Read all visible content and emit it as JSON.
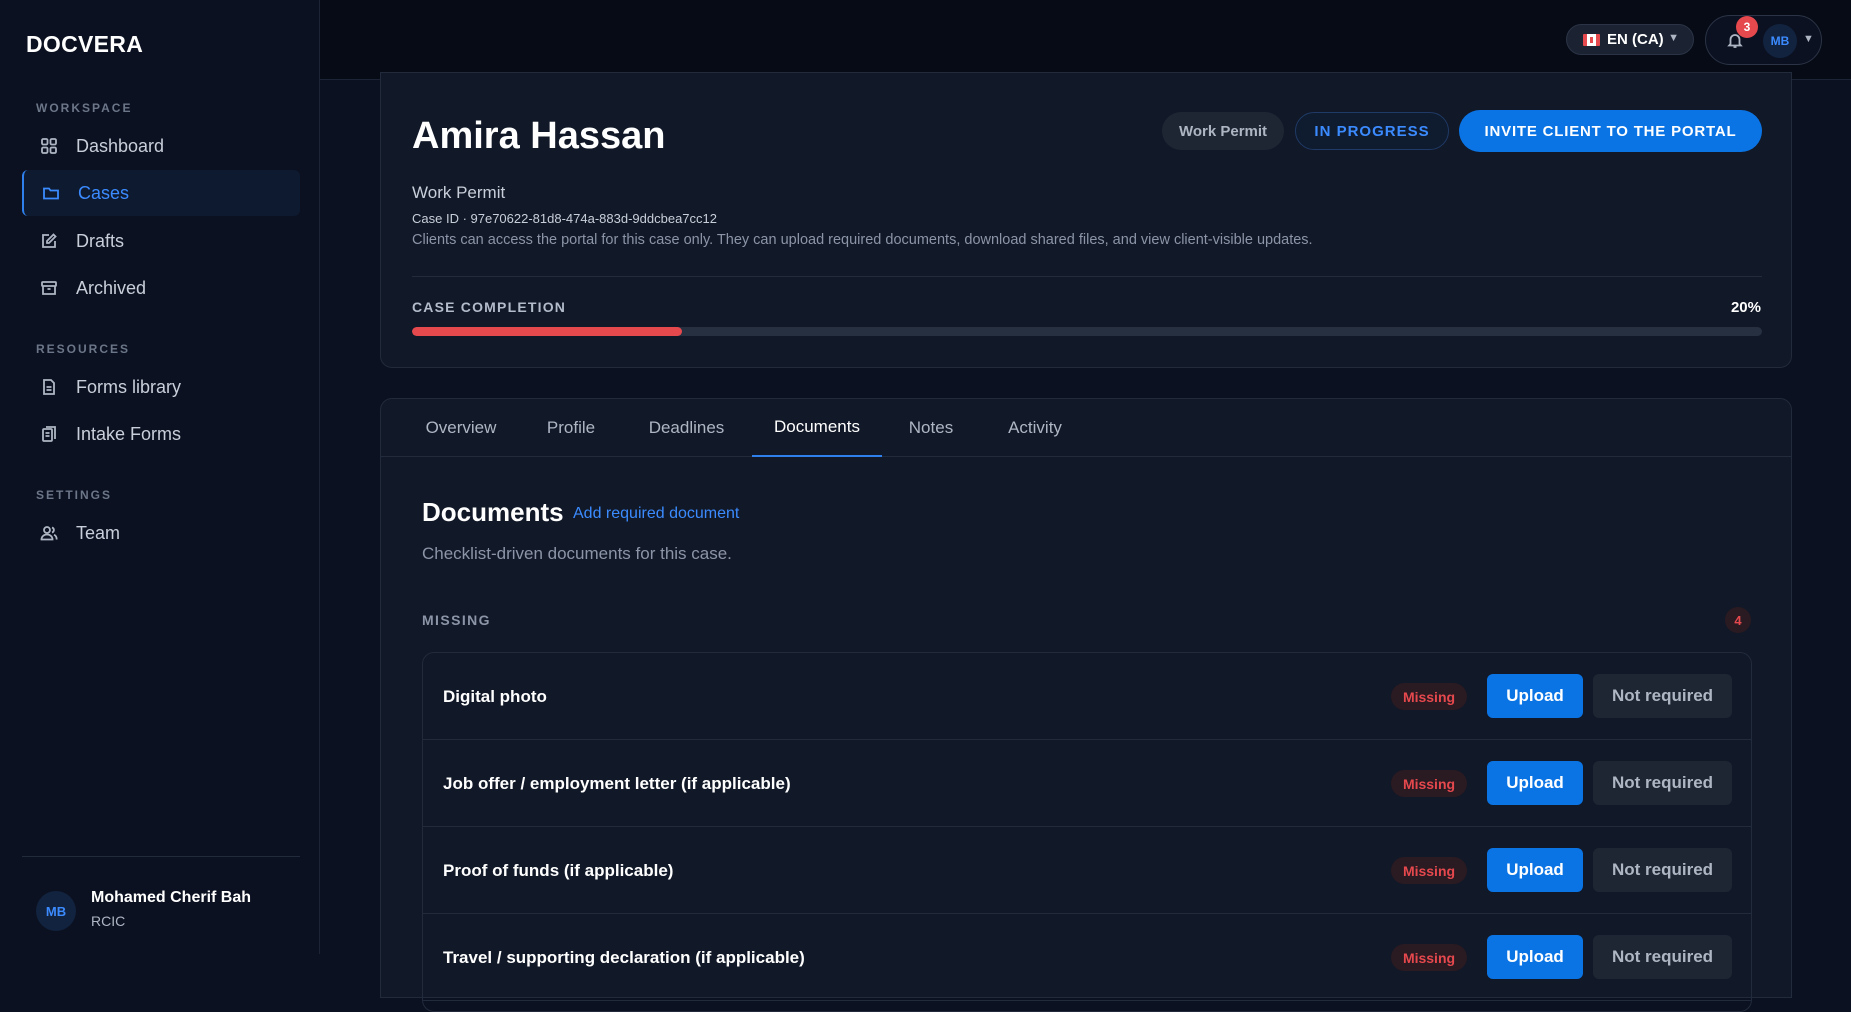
{
  "brand": "DOCVERA",
  "sidebar": {
    "sections": [
      {
        "label": "WORKSPACE",
        "items": [
          {
            "label": "Dashboard",
            "icon": "grid-icon"
          },
          {
            "label": "Cases",
            "icon": "folder-icon",
            "active": true
          },
          {
            "label": "Drafts",
            "icon": "edit-icon"
          },
          {
            "label": "Archived",
            "icon": "archive-icon"
          }
        ]
      },
      {
        "label": "RESOURCES",
        "items": [
          {
            "label": "Forms library",
            "icon": "document-icon"
          },
          {
            "label": "Intake Forms",
            "icon": "clipboard-icon"
          }
        ]
      },
      {
        "label": "SETTINGS",
        "items": [
          {
            "label": "Team",
            "icon": "users-icon"
          }
        ]
      }
    ],
    "user": {
      "initials": "MB",
      "name": "Mohamed Cherif Bah",
      "role": "RCIC"
    }
  },
  "topbar": {
    "language": "EN (CA)",
    "notifications_count": "3",
    "avatar_initials": "MB"
  },
  "case": {
    "client_name": "Amira Hassan",
    "type": "Work Permit",
    "case_id": "Case ID · 97e70622-81d8-474a-883d-9ddcbea7cc12",
    "description": "Clients can access the portal for this case only. They can upload required documents, download shared files, and view client-visible updates.",
    "type_chip": "Work Permit",
    "status": "IN PROGRESS",
    "invite_label": "INVITE CLIENT TO THE PORTAL",
    "completion_label": "CASE COMPLETION",
    "completion_text": "20%",
    "completion_value": 0.2
  },
  "tabs": [
    "Overview",
    "Profile",
    "Deadlines",
    "Documents",
    "Notes",
    "Activity"
  ],
  "active_tab": "Documents",
  "documents": {
    "title": "Documents",
    "add_link": "Add required document",
    "subtitle": "Checklist-driven documents for this case.",
    "missing_label": "MISSING",
    "missing_count": "4",
    "upload_label": "Upload",
    "not_required_label": "Not required",
    "items": [
      {
        "name": "Digital photo",
        "status": "Missing"
      },
      {
        "name": "Job offer / employment letter (if applicable)",
        "status": "Missing"
      },
      {
        "name": "Proof of funds (if applicable)",
        "status": "Missing"
      },
      {
        "name": "Travel / supporting declaration (if applicable)",
        "status": "Missing"
      }
    ]
  },
  "colors": {
    "accent": "#0b74e5",
    "danger": "#e5484d",
    "background": "#0b1120"
  }
}
